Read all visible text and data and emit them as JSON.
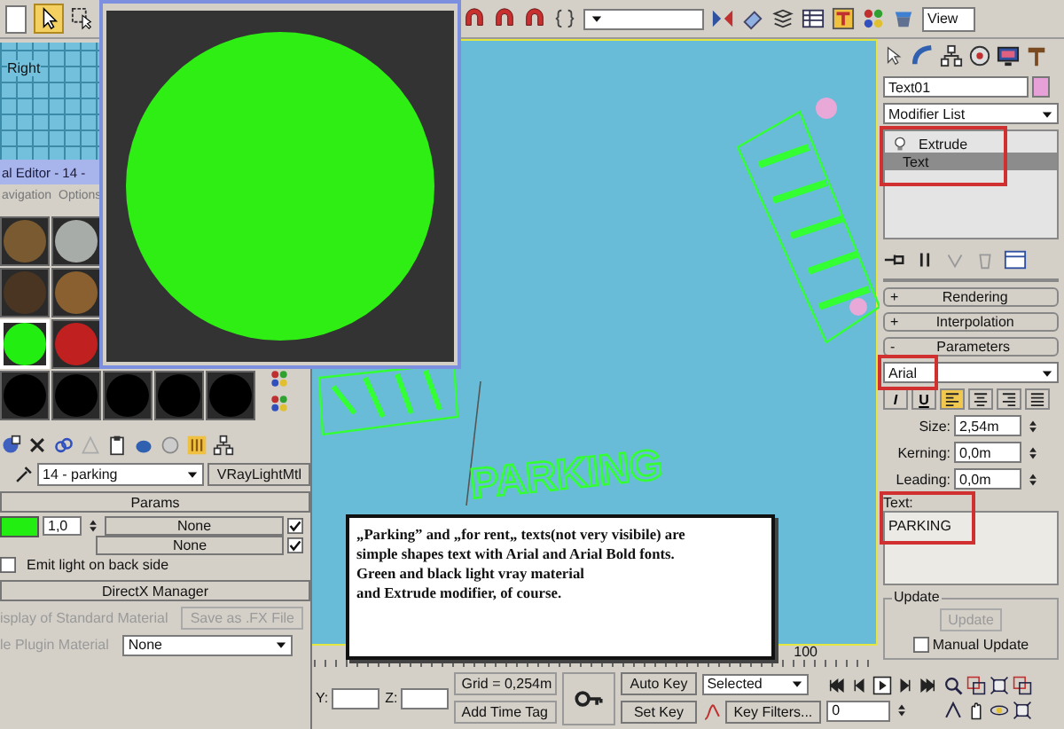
{
  "toolbar": {
    "view_dropdown": "View"
  },
  "small_viewport": {
    "label": "Right"
  },
  "material_editor": {
    "title": "al Editor - 14 -",
    "menu": [
      "avigation",
      "Options"
    ],
    "slot_rows": [
      [
        {
          "color": "#7a5a30",
          "selected": false
        },
        {
          "color": "#a8aca8",
          "selected": false
        }
      ],
      [
        {
          "color": "#4a3522",
          "selected": false
        },
        {
          "color": "#8a6030",
          "selected": false
        }
      ],
      [
        {
          "color": "#22ee11",
          "selected": true
        },
        {
          "color": "#c02020",
          "selected": false
        }
      ],
      [
        {
          "color": "#000000",
          "selected": false
        },
        {
          "color": "#000000",
          "selected": false
        },
        {
          "color": "#000000",
          "selected": false
        },
        {
          "color": "#000000",
          "selected": false
        },
        {
          "color": "#000000",
          "selected": false
        }
      ]
    ],
    "material_name": "14 - parking",
    "material_type": "VRayLightMtl",
    "params": {
      "title": "Params",
      "multiplier": "1,0",
      "map_1": "None",
      "map_1_on": true,
      "map_2": "None",
      "map_2_on": true,
      "emit_label": "Emit light on back side",
      "emit_checked": false
    },
    "directx": {
      "title": "DirectX Manager",
      "display_label": "isplay of Standard Material",
      "save_button": "Save as .FX File",
      "disabled": true,
      "plugin_label": "le Plugin Material",
      "plugin_value": "None"
    }
  },
  "viewport": {
    "scene_text": "PARKING"
  },
  "annotation": {
    "text": "„Parking” and „for rent„ texts(not very visibile) are\nsimple shapes text with Arial and Arial Bold fonts.\nGreen and black light vray material\nand Extrude modifier, of course."
  },
  "timeline": {
    "end_label": "100"
  },
  "command_panel": {
    "object_name": "Text01",
    "modifier_list": "Modifier List",
    "stack": [
      {
        "label": "Extrude",
        "kind": "modifier",
        "selected": false
      },
      {
        "label": "Text",
        "kind": "base",
        "selected": true
      }
    ],
    "stack_highlighted": true,
    "rollouts": [
      {
        "sign": "+",
        "label": "Rendering"
      },
      {
        "sign": "+",
        "label": "Interpolation"
      },
      {
        "sign": "-",
        "label": "Parameters"
      }
    ],
    "font": "Arial",
    "font_highlighted": true,
    "style_buttons": [
      {
        "kind": "italic",
        "label": "I",
        "selected": false
      },
      {
        "kind": "underline",
        "label": "U",
        "selected": false
      },
      {
        "kind": "align-left",
        "selected": true
      },
      {
        "kind": "align-center",
        "selected": false
      },
      {
        "kind": "align-right",
        "selected": false
      },
      {
        "kind": "justify",
        "selected": false
      }
    ],
    "spinners": [
      {
        "label": "Size:",
        "value": "2,54m"
      },
      {
        "label": "Kerning:",
        "value": "0,0m"
      },
      {
        "label": "Leading:",
        "value": "0,0m"
      }
    ],
    "text_label": "Text:",
    "text_value": "PARKING",
    "text_highlighted": true,
    "update": {
      "title": "Update",
      "button": "Update",
      "button_disabled": true,
      "manual_label": "Manual Update",
      "manual_checked": false
    }
  },
  "status": {
    "y_label": "Y:",
    "z_label": "Z:",
    "grid": "Grid = 0,254m",
    "time_tag": "Add Time Tag",
    "auto_key": "Auto Key",
    "set_key": "Set Key",
    "key_mode": "Selected",
    "key_filters": "Key Filters...",
    "frame": "0"
  }
}
